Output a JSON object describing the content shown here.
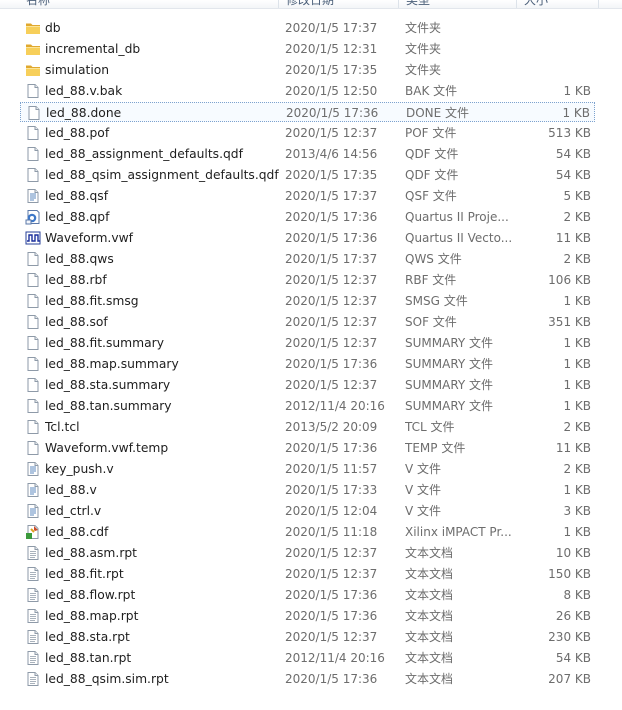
{
  "columns": {
    "name": "名称",
    "date": "修改日期",
    "type": "类型",
    "size": "大小"
  },
  "files": [
    {
      "name": "db",
      "date": "2020/1/5 17:37",
      "type": "文件夹",
      "size": "",
      "icon": "folder-icon"
    },
    {
      "name": "incremental_db",
      "date": "2020/1/5 12:31",
      "type": "文件夹",
      "size": "",
      "icon": "folder-icon"
    },
    {
      "name": "simulation",
      "date": "2020/1/5 17:35",
      "type": "文件夹",
      "size": "",
      "icon": "folder-icon"
    },
    {
      "name": "led_88.v.bak",
      "date": "2020/1/5 12:50",
      "type": "BAK 文件",
      "size": "1 KB",
      "icon": "file-icon"
    },
    {
      "name": "led_88.done",
      "date": "2020/1/5 17:36",
      "type": "DONE 文件",
      "size": "1 KB",
      "icon": "file-icon",
      "focused": true
    },
    {
      "name": "led_88.pof",
      "date": "2020/1/5 12:37",
      "type": "POF 文件",
      "size": "513 KB",
      "icon": "file-icon"
    },
    {
      "name": "led_88_assignment_defaults.qdf",
      "date": "2013/4/6 14:56",
      "type": "QDF 文件",
      "size": "54 KB",
      "icon": "file-icon"
    },
    {
      "name": "led_88_qsim_assignment_defaults.qdf",
      "date": "2020/1/5 17:35",
      "type": "QDF 文件",
      "size": "54 KB",
      "icon": "file-icon"
    },
    {
      "name": "led_88.qsf",
      "date": "2020/1/5 17:37",
      "type": "QSF 文件",
      "size": "5 KB",
      "icon": "text-file-icon"
    },
    {
      "name": "led_88.qpf",
      "date": "2020/1/5 17:36",
      "type": "Quartus II Proje...",
      "size": "2 KB",
      "icon": "quartus-project-icon"
    },
    {
      "name": "Waveform.vwf",
      "date": "2020/1/5 17:36",
      "type": "Quartus II Vecto...",
      "size": "11 KB",
      "icon": "waveform-icon"
    },
    {
      "name": "led_88.qws",
      "date": "2020/1/5 17:37",
      "type": "QWS 文件",
      "size": "2 KB",
      "icon": "file-icon"
    },
    {
      "name": "led_88.rbf",
      "date": "2020/1/5 12:37",
      "type": "RBF 文件",
      "size": "106 KB",
      "icon": "file-icon"
    },
    {
      "name": "led_88.fit.smsg",
      "date": "2020/1/5 12:37",
      "type": "SMSG 文件",
      "size": "1 KB",
      "icon": "file-icon"
    },
    {
      "name": "led_88.sof",
      "date": "2020/1/5 12:37",
      "type": "SOF 文件",
      "size": "351 KB",
      "icon": "file-icon"
    },
    {
      "name": "led_88.fit.summary",
      "date": "2020/1/5 12:37",
      "type": "SUMMARY 文件",
      "size": "1 KB",
      "icon": "file-icon"
    },
    {
      "name": "led_88.map.summary",
      "date": "2020/1/5 17:36",
      "type": "SUMMARY 文件",
      "size": "1 KB",
      "icon": "file-icon"
    },
    {
      "name": "led_88.sta.summary",
      "date": "2020/1/5 12:37",
      "type": "SUMMARY 文件",
      "size": "1 KB",
      "icon": "file-icon"
    },
    {
      "name": "led_88.tan.summary",
      "date": "2012/11/4 20:16",
      "type": "SUMMARY 文件",
      "size": "1 KB",
      "icon": "file-icon"
    },
    {
      "name": "Tcl.tcl",
      "date": "2013/5/2 20:09",
      "type": "TCL 文件",
      "size": "2 KB",
      "icon": "file-icon"
    },
    {
      "name": "Waveform.vwf.temp",
      "date": "2020/1/5 17:36",
      "type": "TEMP 文件",
      "size": "11 KB",
      "icon": "file-icon"
    },
    {
      "name": "key_push.v",
      "date": "2020/1/5 11:57",
      "type": "V 文件",
      "size": "2 KB",
      "icon": "text-file-icon"
    },
    {
      "name": "led_88.v",
      "date": "2020/1/5 17:33",
      "type": "V 文件",
      "size": "1 KB",
      "icon": "text-file-icon"
    },
    {
      "name": "led_ctrl.v",
      "date": "2020/1/5 12:04",
      "type": "V 文件",
      "size": "3 KB",
      "icon": "text-file-icon"
    },
    {
      "name": "led_88.cdf",
      "date": "2020/1/5 11:18",
      "type": "Xilinx iMPACT Pr...",
      "size": "1 KB",
      "icon": "impact-icon"
    },
    {
      "name": "led_88.asm.rpt",
      "date": "2020/1/5 12:37",
      "type": "文本文档",
      "size": "10 KB",
      "icon": "text-doc-icon"
    },
    {
      "name": "led_88.fit.rpt",
      "date": "2020/1/5 12:37",
      "type": "文本文档",
      "size": "150 KB",
      "icon": "text-doc-icon"
    },
    {
      "name": "led_88.flow.rpt",
      "date": "2020/1/5 17:36",
      "type": "文本文档",
      "size": "8 KB",
      "icon": "text-doc-icon"
    },
    {
      "name": "led_88.map.rpt",
      "date": "2020/1/5 17:36",
      "type": "文本文档",
      "size": "26 KB",
      "icon": "text-doc-icon"
    },
    {
      "name": "led_88.sta.rpt",
      "date": "2020/1/5 12:37",
      "type": "文本文档",
      "size": "230 KB",
      "icon": "text-doc-icon"
    },
    {
      "name": "led_88.tan.rpt",
      "date": "2012/11/4 20:16",
      "type": "文本文档",
      "size": "54 KB",
      "icon": "text-doc-icon"
    },
    {
      "name": "led_88_qsim.sim.rpt",
      "date": "2020/1/5 17:36",
      "type": "文本文档",
      "size": "207 KB",
      "icon": "text-doc-icon"
    }
  ]
}
